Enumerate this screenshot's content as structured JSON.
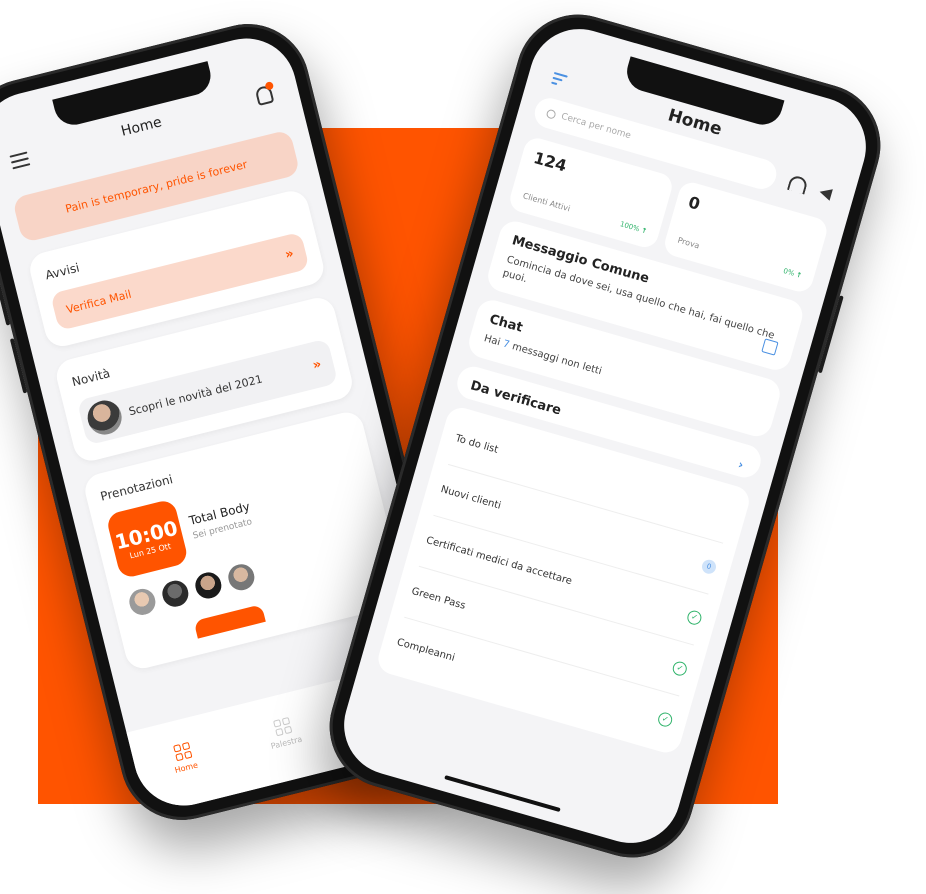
{
  "colors": {
    "accent": "#ff5400",
    "blue": "#4a90e2",
    "green": "#2fb36a"
  },
  "left_phone": {
    "title": "Home",
    "quote": "Pain is temporary, pride is forever",
    "avvisi": {
      "title": "Avvisi",
      "item": "Verifica Mail"
    },
    "novita": {
      "title": "Novità",
      "item": "Scopri le novità del 2021"
    },
    "prenotazioni": {
      "title": "Prenotazioni",
      "time": "10:00",
      "date": "Lun 25 Ott",
      "class_name": "Total Body",
      "status": "Sei prenotato"
    },
    "tabbar": {
      "home": "Home",
      "second": "Palestra"
    }
  },
  "right_phone": {
    "title": "Home",
    "search_placeholder": "Cerca per nome",
    "stats": [
      {
        "value": "124",
        "label": "Clienti Attivi",
        "trend": "100%"
      },
      {
        "value": "0",
        "label": "Prova",
        "trend": "0%"
      }
    ],
    "messaggio": {
      "title": "Messaggio Comune",
      "body": "Comincia da dove sei, usa quello che hai, fai quello che puoi."
    },
    "chat": {
      "title": "Chat",
      "prefix": "Hai",
      "count": "7",
      "suffix": "messaggi non letti"
    },
    "da_verificare": {
      "title": "Da verificare",
      "items": [
        {
          "label": "To do list",
          "badge": ""
        },
        {
          "label": "Nuovi clienti",
          "badge": "0"
        },
        {
          "label": "Certificati medici da accettare",
          "badge": "check"
        },
        {
          "label": "Green Pass",
          "badge": "check"
        },
        {
          "label": "Compleanni",
          "badge": "check"
        }
      ]
    }
  }
}
